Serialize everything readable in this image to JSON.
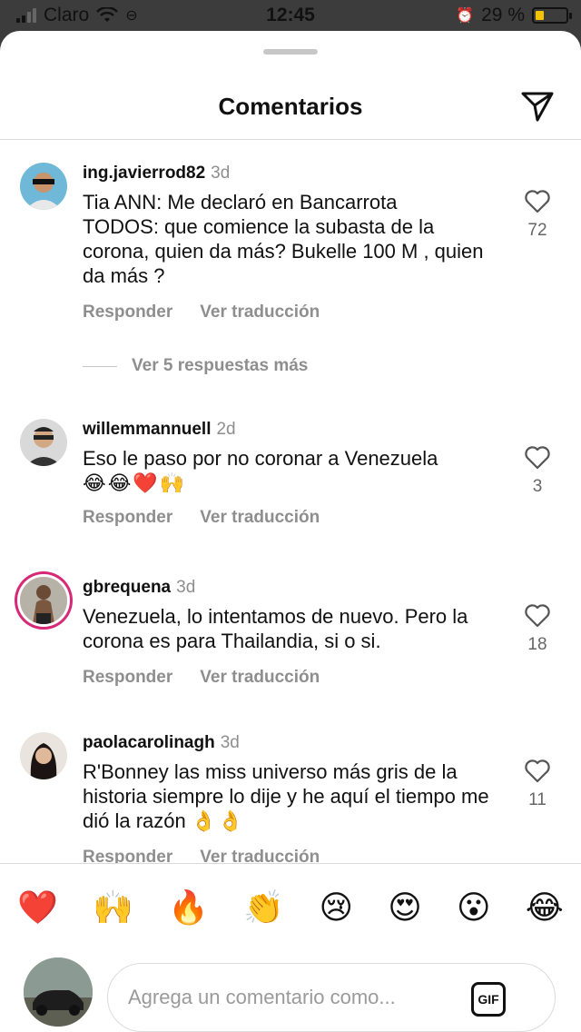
{
  "status": {
    "carrier": "Claro",
    "time": "12:45",
    "battery": "29 %"
  },
  "header": {
    "title": "Comentarios"
  },
  "comments": [
    {
      "username": "ing.javierrod82",
      "time": "3d",
      "text": "Tia ANN: Me declaró en Bancarrota\nTODOS: que comience la subasta de la corona, quien da más? Bukelle 100 M , quien da más ?",
      "emojis": "",
      "likes": "72",
      "reply": "Responder",
      "translate": "Ver traducción",
      "more_replies": "Ver 5 respuestas más"
    },
    {
      "username": "willemmannuell",
      "time": "2d",
      "text": "Eso le paso por no coronar a Venezuela",
      "emojis": "😂😂❤️🙌",
      "likes": "3",
      "reply": "Responder",
      "translate": "Ver traducción"
    },
    {
      "username": "gbrequena",
      "time": "3d",
      "text": "Venezuela, lo intentamos de nuevo. Pero la corona es para Thailandia, si o si.",
      "emojis": "",
      "likes": "18",
      "reply": "Responder",
      "translate": "Ver traducción"
    },
    {
      "username": "paolacarolinagh",
      "time": "3d",
      "text": "R'Bonney las miss universo más gris de la historia siempre lo dije y he aquí el tiempo me dió la razón",
      "emojis": "👌👌",
      "likes": "11",
      "reply": "Responder",
      "translate": "Ver traducción"
    }
  ],
  "emoji_bar": [
    "❤️",
    "🙌",
    "🔥",
    "👏",
    "😢",
    "😍",
    "😮",
    "😂"
  ],
  "composer": {
    "placeholder": "Agrega un comentario como...",
    "gif": "GIF"
  },
  "icons": {
    "share": "paper-plane-icon",
    "like": "heart-outline-icon",
    "gif": "gif-icon"
  }
}
